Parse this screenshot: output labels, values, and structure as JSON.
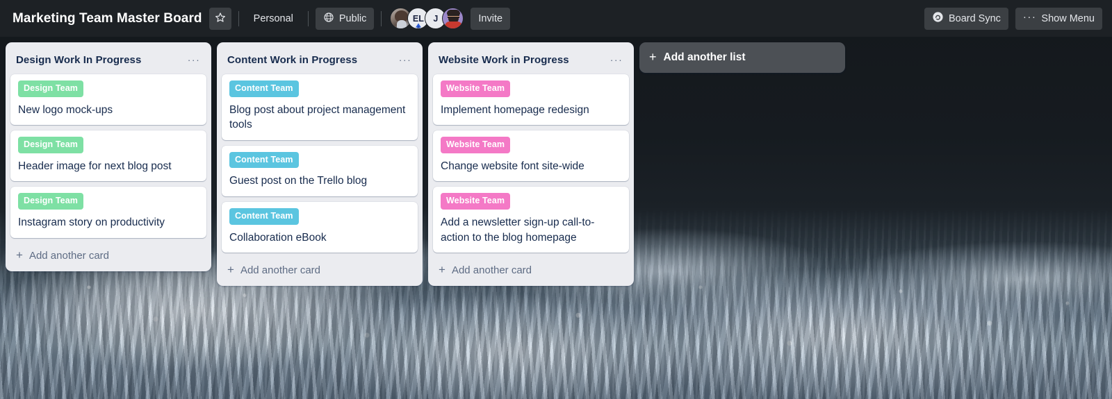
{
  "header": {
    "board_title": "Marketing Team Master Board",
    "star_icon": "star-outline-icon",
    "workspace_label": "Personal",
    "visibility_label": "Public",
    "visibility_icon": "globe-icon",
    "invite_label": "Invite",
    "board_sync_label": "Board Sync",
    "board_sync_icon": "sync-circle-icon",
    "show_menu_label": "Show Menu",
    "show_menu_icon": "ellipsis-icon",
    "members": [
      {
        "type": "photo",
        "name": "member-photo-avatar",
        "initials": ""
      },
      {
        "type": "initials",
        "name": "member-el-avatar",
        "initials": "EL",
        "badge": "atlassian-badge-icon"
      },
      {
        "type": "initials",
        "name": "member-j-avatar",
        "initials": "J",
        "badge": ""
      },
      {
        "type": "cartoon",
        "name": "member-cartoon-avatar",
        "initials": ""
      }
    ]
  },
  "board": {
    "add_list_label": "Add another list",
    "add_card_label": "Add another card",
    "list_menu_glyph": "···",
    "lists": [
      {
        "title": "Design Work In Progress",
        "label_color": "#7ee0a4",
        "cards": [
          {
            "label": "Design Team",
            "title": "New logo mock-ups"
          },
          {
            "label": "Design Team",
            "title": "Header image for next blog post"
          },
          {
            "label": "Design Team",
            "title": "Instagram story on productivity"
          }
        ]
      },
      {
        "title": "Content Work in Progress",
        "label_color": "#5bc5e0",
        "cards": [
          {
            "label": "Content Team",
            "title": "Blog post about project management tools"
          },
          {
            "label": "Content Team",
            "title": "Guest post on the Trello blog"
          },
          {
            "label": "Content Team",
            "title": "Collaboration eBook"
          }
        ]
      },
      {
        "title": "Website Work in Progress",
        "label_color": "#f479c6",
        "cards": [
          {
            "label": "Website Team",
            "title": "Implement homepage redesign"
          },
          {
            "label": "Website Team",
            "title": "Change website font site-wide"
          },
          {
            "label": "Website Team",
            "title": "Add a newsletter sign-up call-to-action to the blog homepage"
          }
        ]
      }
    ]
  }
}
